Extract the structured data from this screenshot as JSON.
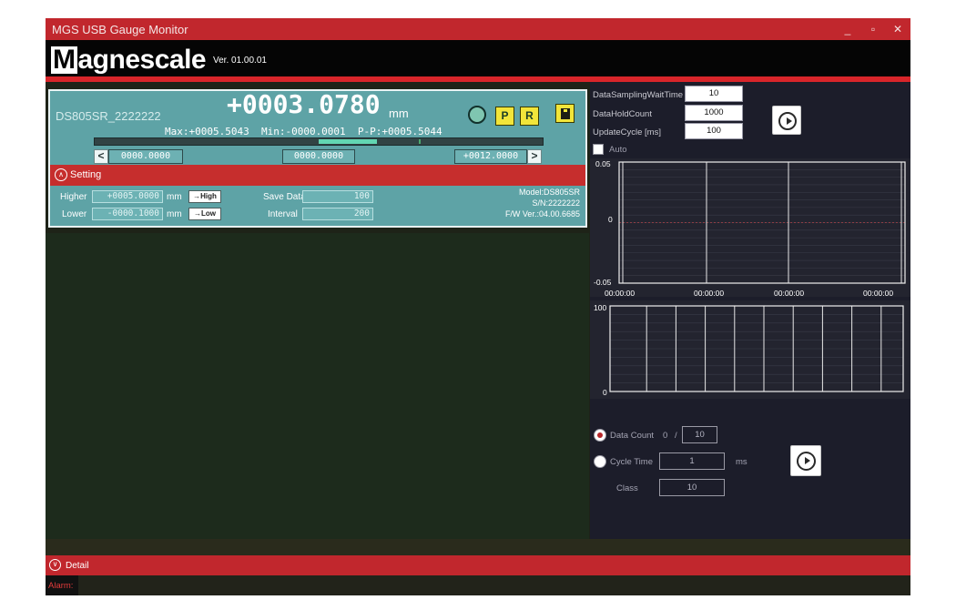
{
  "window": {
    "title": "MGS USB Gauge Monitor",
    "minimize_glyph": "_",
    "maximize_glyph": "▫",
    "close_glyph": "✕"
  },
  "brand": {
    "logo_first": "M",
    "logo_rest": "agnescale",
    "version": "Ver. 01.00.01"
  },
  "gauge": {
    "device_name": "DS805SR_2222222",
    "value": "+0003.0780",
    "unit": "mm",
    "stats": "Max:+0005.5043  Min:-0000.0001  P-P:+0005.5044",
    "preset_button": "P",
    "reset_button": "R",
    "range_left_arrow": "<",
    "range_right_arrow": ">",
    "range_min": "0000.0000",
    "range_mid": "0000.0000",
    "range_max": "+0012.0000",
    "setting_label": "Setting",
    "higher_label": "Higher",
    "higher_value": "+0005.0000",
    "lower_label": "Lower",
    "lower_value": "-0000.1000",
    "mm1": "mm",
    "mm2": "mm",
    "high_button": "→High",
    "low_button": "→Low",
    "save_data_label": "Save Data",
    "save_data_value": "100",
    "interval_label": "Interval",
    "interval_value": "200",
    "model": "Model:DS805SR",
    "serial": "S/N:2222222",
    "firmware": "F/W Ver.:04.00.6685"
  },
  "config": {
    "data_sampling_wait_time_label": "DataSamplingWaitTime",
    "data_sampling_wait_time": "10",
    "data_hold_count_label": "DataHoldCount",
    "data_hold_count": "1000",
    "update_cycle_label": "UpdateCycle [ms]",
    "update_cycle": "100",
    "auto_label": "Auto"
  },
  "chart_data": [
    {
      "type": "line",
      "x_tick_labels": [
        "00:00:00",
        "00:00:00",
        "00:00:00",
        "00:00:00"
      ],
      "y_tick_labels": [
        "0.05",
        "0",
        "-0.05"
      ],
      "ylim": [
        -0.05,
        0.05
      ],
      "reference_line": 0,
      "grid": true,
      "series": []
    },
    {
      "type": "bar",
      "y_tick_labels": [
        "100",
        "0"
      ],
      "ylim": [
        0,
        100
      ],
      "grid": true,
      "series": []
    }
  ],
  "acquisition": {
    "data_count_label": "Data Count",
    "data_count_current": "0",
    "separator": "/",
    "data_count_target": "10",
    "cycle_time_label": "Cycle Time",
    "cycle_time": "1",
    "cycle_time_unit": "ms",
    "class_label": "Class",
    "class_value": "10"
  },
  "footer": {
    "detail_label": "Detail",
    "alarm_label": "Alarm:"
  },
  "colors": {
    "title_red": "#c1272d",
    "gauge_teal": "#5ea3a6",
    "led_green": "#7fc6b0",
    "button_yellow": "#f2e53a",
    "reference_red": "#e04040"
  }
}
